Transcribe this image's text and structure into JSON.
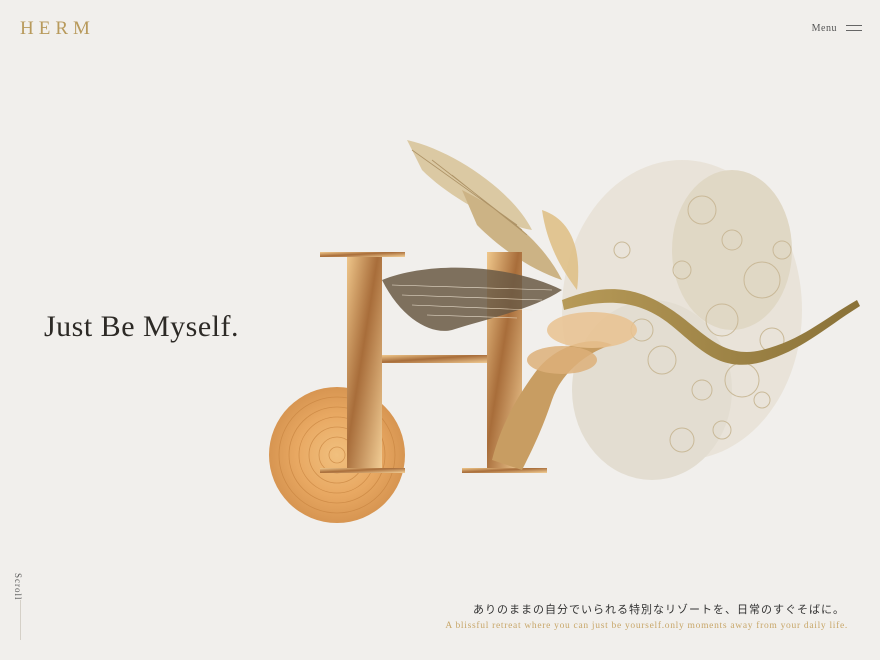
{
  "header": {
    "logo": "HERM",
    "menu_label": "Menu"
  },
  "hero": {
    "headline": "Just Be Myself.",
    "illustration_icon": "herm-monogram-illustration"
  },
  "scroll": {
    "label": "Scroll"
  },
  "footer": {
    "caption_jp": "ありのままの自分でいられる特別なリゾートを、日常のすぐそばに。",
    "caption_en": "A blissful retreat where you can just be yourself.only moments away from your daily life."
  },
  "colors": {
    "background": "#f1efec",
    "accent_gold": "#b89a5c",
    "text_dark": "#2d2a26"
  }
}
